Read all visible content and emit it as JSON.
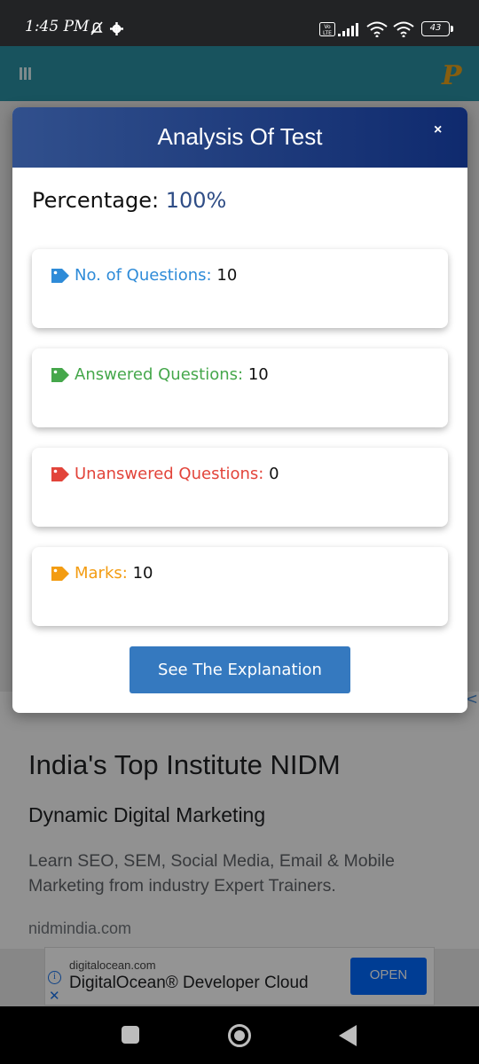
{
  "status_bar": {
    "time": "1:45 PM",
    "battery": "43",
    "network_badge": "Vo LTE"
  },
  "app_bar": {
    "logo_letter": "P"
  },
  "modal": {
    "title": "Analysis Of Test",
    "close_label": "×",
    "percentage_label": "Percentage:",
    "percentage_value": "100%",
    "stats": [
      {
        "label": "No. of Questions:",
        "value": "10",
        "color": "#2e8bd8",
        "icon": "tag-icon"
      },
      {
        "label": "Answered Questions:",
        "value": "10",
        "color": "#45a74b",
        "icon": "tag-icon"
      },
      {
        "label": "Unanswered Questions:",
        "value": "0",
        "color": "#e2443a",
        "icon": "tag-icon"
      },
      {
        "label": "Marks:",
        "value": "10",
        "color": "#f39c12",
        "icon": "tag-icon"
      }
    ],
    "explanation_button": "See The Explanation"
  },
  "ad": {
    "title": "India's Top Institute NIDM",
    "subtitle": "Dynamic Digital Marketing",
    "description": "Learn SEO, SEM, Social Media, Email & Mobile Marketing from industry Expert Trainers.",
    "url": "nidmindia.com",
    "close_label": "<"
  },
  "banner": {
    "domain": "digitalocean.com",
    "title": "DigitalOcean® Developer Cloud",
    "open_label": "OPEN",
    "info_label": "i",
    "close_label": "✕"
  },
  "colors": {
    "header_gradient_start": "#31508d",
    "header_gradient_end": "#0f2a6e",
    "button_blue": "#3579bf",
    "app_bar": "#2a8fa3"
  }
}
